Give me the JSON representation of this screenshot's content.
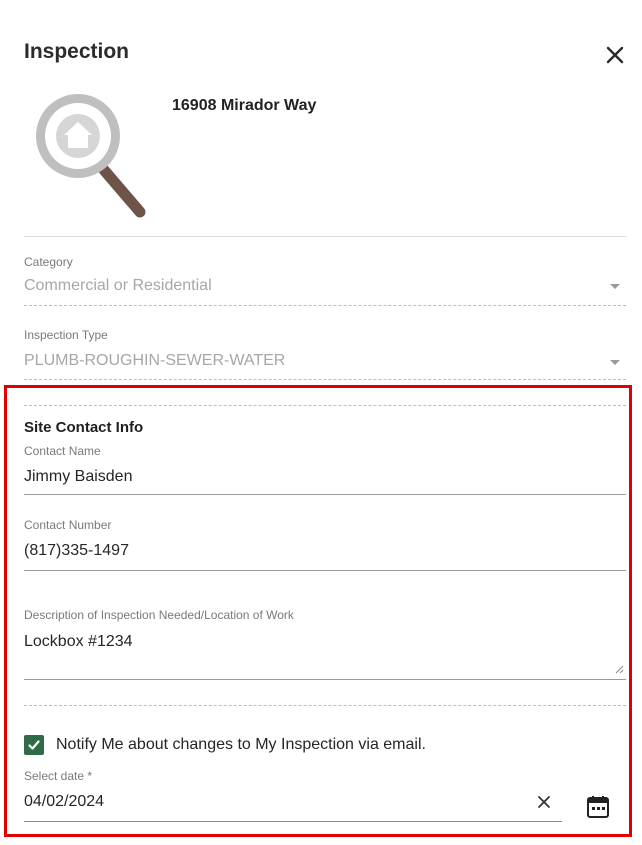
{
  "header": {
    "title": "Inspection",
    "close_icon": "close-icon"
  },
  "property": {
    "address": "16908 Mirador Way",
    "logo_icon": "house-magnifier-icon"
  },
  "category": {
    "label": "Category",
    "value": "Commercial or Residential"
  },
  "inspection_type": {
    "label": "Inspection Type",
    "value": "PLUMB-ROUGHIN-SEWER-WATER"
  },
  "site_contact": {
    "heading": "Site Contact Info",
    "contact_name_label": "Contact Name",
    "contact_name_value": "Jimmy Baisden",
    "contact_number_label": "Contact Number",
    "contact_number_value": "(817)335-1497",
    "description_label": "Description of Inspection Needed/Location of Work",
    "description_value": "Lockbox #1234"
  },
  "notify": {
    "label": "Notify Me about changes to My Inspection via email.",
    "checked": true
  },
  "date": {
    "label": "Select date *",
    "value": "04/02/2024",
    "clear_icon": "clear-icon",
    "calendar_icon": "calendar-icon"
  },
  "colors": {
    "accent_green": "#2f6b47",
    "highlight_red": "#e10000"
  }
}
